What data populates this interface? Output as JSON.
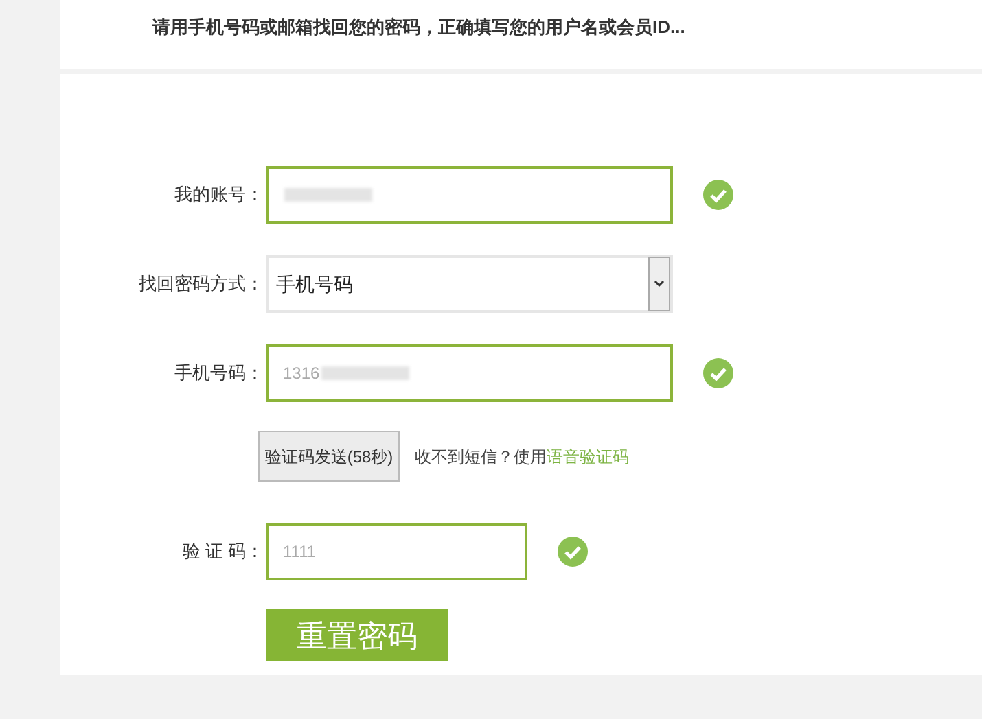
{
  "notice": "请用手机号码或邮箱找回您的密码，正确填写您的用户名或会员ID...",
  "fields": [
    {
      "kind": "input",
      "label": "我的账号：",
      "redacted": true,
      "valid": true,
      "wide": true
    },
    {
      "kind": "select",
      "label": "找回密码方式：",
      "value": "手机号码"
    },
    {
      "kind": "input",
      "label": "手机号码：",
      "value": "1316",
      "redacted": true,
      "valid": true,
      "wide": true
    },
    {
      "kind": "sms",
      "button": "验证码发送(58秒)",
      "hint": "收不到短信？使用",
      "link": "语音验证码"
    },
    {
      "kind": "input",
      "label": "验 证 码：",
      "value": "1111",
      "redacted": false,
      "valid": true,
      "wide": false
    }
  ],
  "submit": "重置密码"
}
